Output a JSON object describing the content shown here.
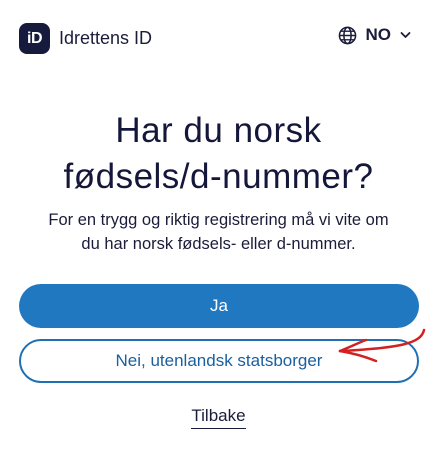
{
  "header": {
    "logo_badge": "iD",
    "logo_text": "Idrettens ID",
    "language": "NO"
  },
  "main": {
    "title_line1": "Har du norsk",
    "title_line2": "fødsels/d-nummer?",
    "subtitle_line1": "For en trygg og riktig registrering må vi vite om",
    "subtitle_line2": "du har norsk fødsels- eller d-nummer.",
    "yes_button": "Ja",
    "no_button": "Nei, utenlandsk statsborger",
    "back_link": "Tilbake"
  },
  "colors": {
    "primary": "#1f78c0",
    "dark": "#161b3d",
    "annotation": "#d42020"
  },
  "icons": {
    "language": "globe-icon",
    "dropdown": "chevron-down-icon"
  }
}
